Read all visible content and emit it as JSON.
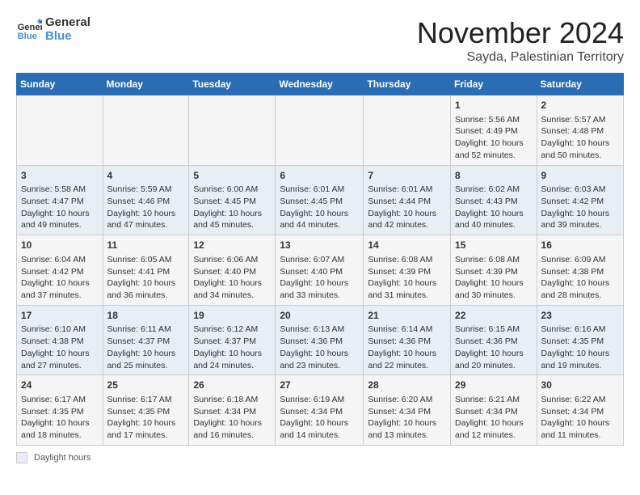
{
  "header": {
    "logo_line1": "General",
    "logo_line2": "Blue",
    "month_title": "November 2024",
    "subtitle": "Sayda, Palestinian Territory"
  },
  "days_of_week": [
    "Sunday",
    "Monday",
    "Tuesday",
    "Wednesday",
    "Thursday",
    "Friday",
    "Saturday"
  ],
  "weeks": [
    [
      {
        "day": "",
        "info": ""
      },
      {
        "day": "",
        "info": ""
      },
      {
        "day": "",
        "info": ""
      },
      {
        "day": "",
        "info": ""
      },
      {
        "day": "",
        "info": ""
      },
      {
        "day": "1",
        "info": "Sunrise: 5:56 AM\nSunset: 4:49 PM\nDaylight: 10 hours and 52 minutes."
      },
      {
        "day": "2",
        "info": "Sunrise: 5:57 AM\nSunset: 4:48 PM\nDaylight: 10 hours and 50 minutes."
      }
    ],
    [
      {
        "day": "3",
        "info": "Sunrise: 5:58 AM\nSunset: 4:47 PM\nDaylight: 10 hours and 49 minutes."
      },
      {
        "day": "4",
        "info": "Sunrise: 5:59 AM\nSunset: 4:46 PM\nDaylight: 10 hours and 47 minutes."
      },
      {
        "day": "5",
        "info": "Sunrise: 6:00 AM\nSunset: 4:45 PM\nDaylight: 10 hours and 45 minutes."
      },
      {
        "day": "6",
        "info": "Sunrise: 6:01 AM\nSunset: 4:45 PM\nDaylight: 10 hours and 44 minutes."
      },
      {
        "day": "7",
        "info": "Sunrise: 6:01 AM\nSunset: 4:44 PM\nDaylight: 10 hours and 42 minutes."
      },
      {
        "day": "8",
        "info": "Sunrise: 6:02 AM\nSunset: 4:43 PM\nDaylight: 10 hours and 40 minutes."
      },
      {
        "day": "9",
        "info": "Sunrise: 6:03 AM\nSunset: 4:42 PM\nDaylight: 10 hours and 39 minutes."
      }
    ],
    [
      {
        "day": "10",
        "info": "Sunrise: 6:04 AM\nSunset: 4:42 PM\nDaylight: 10 hours and 37 minutes."
      },
      {
        "day": "11",
        "info": "Sunrise: 6:05 AM\nSunset: 4:41 PM\nDaylight: 10 hours and 36 minutes."
      },
      {
        "day": "12",
        "info": "Sunrise: 6:06 AM\nSunset: 4:40 PM\nDaylight: 10 hours and 34 minutes."
      },
      {
        "day": "13",
        "info": "Sunrise: 6:07 AM\nSunset: 4:40 PM\nDaylight: 10 hours and 33 minutes."
      },
      {
        "day": "14",
        "info": "Sunrise: 6:08 AM\nSunset: 4:39 PM\nDaylight: 10 hours and 31 minutes."
      },
      {
        "day": "15",
        "info": "Sunrise: 6:08 AM\nSunset: 4:39 PM\nDaylight: 10 hours and 30 minutes."
      },
      {
        "day": "16",
        "info": "Sunrise: 6:09 AM\nSunset: 4:38 PM\nDaylight: 10 hours and 28 minutes."
      }
    ],
    [
      {
        "day": "17",
        "info": "Sunrise: 6:10 AM\nSunset: 4:38 PM\nDaylight: 10 hours and 27 minutes."
      },
      {
        "day": "18",
        "info": "Sunrise: 6:11 AM\nSunset: 4:37 PM\nDaylight: 10 hours and 25 minutes."
      },
      {
        "day": "19",
        "info": "Sunrise: 6:12 AM\nSunset: 4:37 PM\nDaylight: 10 hours and 24 minutes."
      },
      {
        "day": "20",
        "info": "Sunrise: 6:13 AM\nSunset: 4:36 PM\nDaylight: 10 hours and 23 minutes."
      },
      {
        "day": "21",
        "info": "Sunrise: 6:14 AM\nSunset: 4:36 PM\nDaylight: 10 hours and 22 minutes."
      },
      {
        "day": "22",
        "info": "Sunrise: 6:15 AM\nSunset: 4:36 PM\nDaylight: 10 hours and 20 minutes."
      },
      {
        "day": "23",
        "info": "Sunrise: 6:16 AM\nSunset: 4:35 PM\nDaylight: 10 hours and 19 minutes."
      }
    ],
    [
      {
        "day": "24",
        "info": "Sunrise: 6:17 AM\nSunset: 4:35 PM\nDaylight: 10 hours and 18 minutes."
      },
      {
        "day": "25",
        "info": "Sunrise: 6:17 AM\nSunset: 4:35 PM\nDaylight: 10 hours and 17 minutes."
      },
      {
        "day": "26",
        "info": "Sunrise: 6:18 AM\nSunset: 4:34 PM\nDaylight: 10 hours and 16 minutes."
      },
      {
        "day": "27",
        "info": "Sunrise: 6:19 AM\nSunset: 4:34 PM\nDaylight: 10 hours and 14 minutes."
      },
      {
        "day": "28",
        "info": "Sunrise: 6:20 AM\nSunset: 4:34 PM\nDaylight: 10 hours and 13 minutes."
      },
      {
        "day": "29",
        "info": "Sunrise: 6:21 AM\nSunset: 4:34 PM\nDaylight: 10 hours and 12 minutes."
      },
      {
        "day": "30",
        "info": "Sunrise: 6:22 AM\nSunset: 4:34 PM\nDaylight: 10 hours and 11 minutes."
      }
    ]
  ],
  "legend": {
    "label": "Daylight hours"
  }
}
